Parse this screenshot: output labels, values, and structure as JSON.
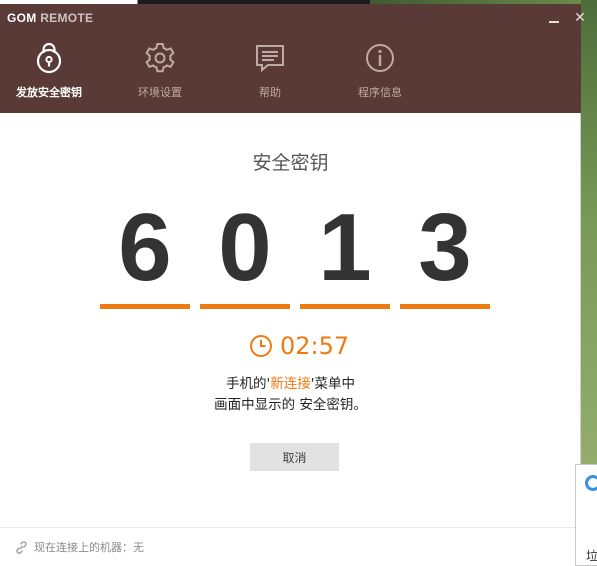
{
  "window": {
    "brand_a": "GOM",
    "brand_b": " REMOTE",
    "minimize_label": "",
    "close_label": "✕"
  },
  "tabs": [
    {
      "label": "发放安全密钥",
      "icon": "lock-icon",
      "active": true
    },
    {
      "label": "环境设置",
      "icon": "gear-icon",
      "active": false
    },
    {
      "label": "帮助",
      "icon": "chat-bubble-icon",
      "active": false
    },
    {
      "label": "程序信息",
      "icon": "info-icon",
      "active": false
    }
  ],
  "main": {
    "title": "安全密钥",
    "digits": [
      "6",
      "0",
      "1",
      "3"
    ],
    "timer": "02:57",
    "instruction_line1_pre": "手机的'",
    "instruction_line1_highlight": "新连接",
    "instruction_line1_post": "'菜单中",
    "instruction_line2": "画面中显示的 安全密钥。",
    "cancel_label": "取消"
  },
  "status": {
    "text": "现在连接上的机器：无"
  },
  "popup": {
    "partial_text": "垃"
  },
  "colors": {
    "header_bg": "#5a3a37",
    "accent": "#ee7b11",
    "digit": "#333333"
  }
}
